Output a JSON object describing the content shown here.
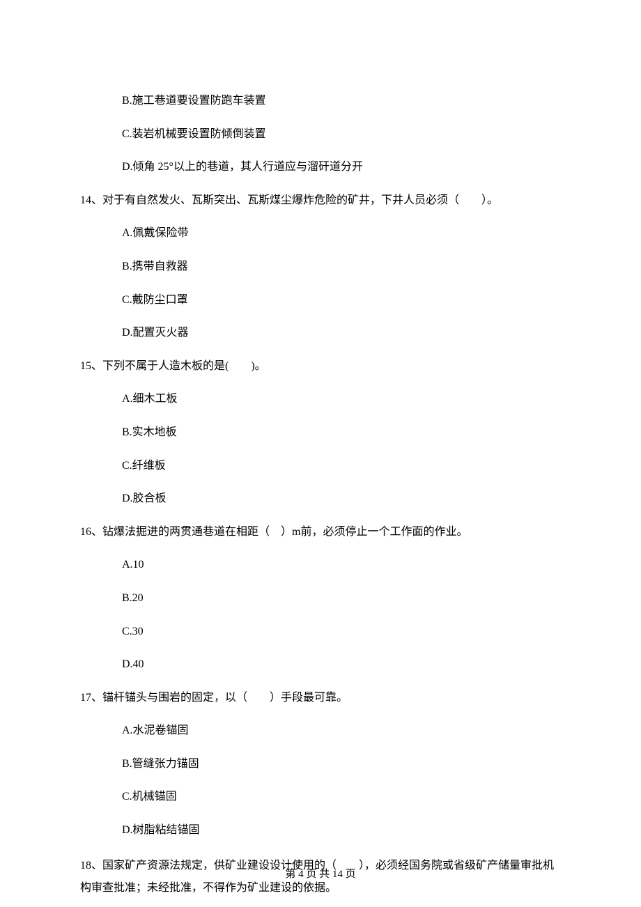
{
  "options_pre": [
    "B.施工巷道要设置防跑车装置",
    "C.装岩机械要设置防倾倒装置",
    "D.倾角 25°以上的巷道，其人行道应与溜矸道分开"
  ],
  "q14": {
    "stem": "14、对于有自然发火、瓦斯突出、瓦斯煤尘爆炸危险的矿井，下井人员必须（　　）。",
    "opts": [
      "A.佩戴保险带",
      "B.携带自救器",
      "C.戴防尘口罩",
      "D.配置灭火器"
    ]
  },
  "q15": {
    "stem": "15、下列不属于人造木板的是(　　)。",
    "opts": [
      "A.细木工板",
      "B.实木地板",
      "C.纤维板",
      "D.胶合板"
    ]
  },
  "q16": {
    "stem": "16、钻爆法掘进的两贯通巷道在相距（　）m前，必须停止一个工作面的作业。",
    "opts": [
      "A.10",
      "B.20",
      "C.30",
      "D.40"
    ]
  },
  "q17": {
    "stem": "17、锚杆锚头与围岩的固定，以（　　）手段最可靠。",
    "opts": [
      "A.水泥卷锚固",
      "B.管缝张力锚固",
      "C.机械锚固",
      "D.树脂粘结锚固"
    ]
  },
  "q18": {
    "stem": "18、国家矿产资源法规定，供矿业建设设计使用的（　　），必须经国务院或省级矿产储量审批机构审查批准；未经批准，不得作为矿业建设的依据。"
  },
  "footer": "第 4 页 共 14 页"
}
